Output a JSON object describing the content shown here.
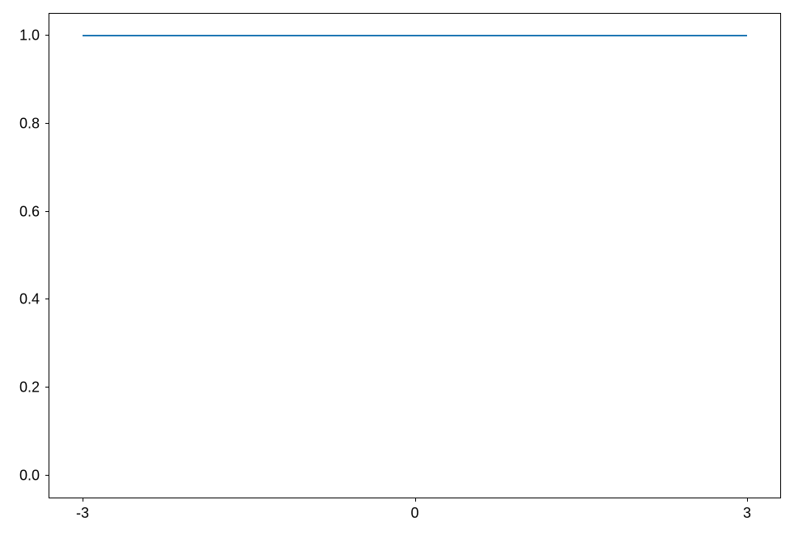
{
  "chart_data": {
    "type": "line",
    "x": [
      -3,
      3
    ],
    "y": [
      1,
      1
    ],
    "title": "",
    "xlabel": "",
    "ylabel": "",
    "xlim": [
      -3.3,
      3.3
    ],
    "ylim": [
      -0.05,
      1.05
    ],
    "x_ticks": [
      {
        "value": -3,
        "label": "-3",
        "frac": 0.04545
      },
      {
        "value": 0,
        "label": "0",
        "frac": 0.5
      },
      {
        "value": 3,
        "label": "3",
        "frac": 0.95455
      }
    ],
    "y_ticks": [
      {
        "value": 0.0,
        "label": "0.0",
        "frac": 0.04545
      },
      {
        "value": 0.2,
        "label": "0.2",
        "frac": 0.22727
      },
      {
        "value": 0.4,
        "label": "0.4",
        "frac": 0.40909
      },
      {
        "value": 0.6,
        "label": "0.6",
        "frac": 0.59091
      },
      {
        "value": 0.8,
        "label": "0.8",
        "frac": 0.77273
      },
      {
        "value": 1.0,
        "label": "1.0",
        "frac": 0.95455
      }
    ],
    "line_color": "#1f77b4"
  }
}
